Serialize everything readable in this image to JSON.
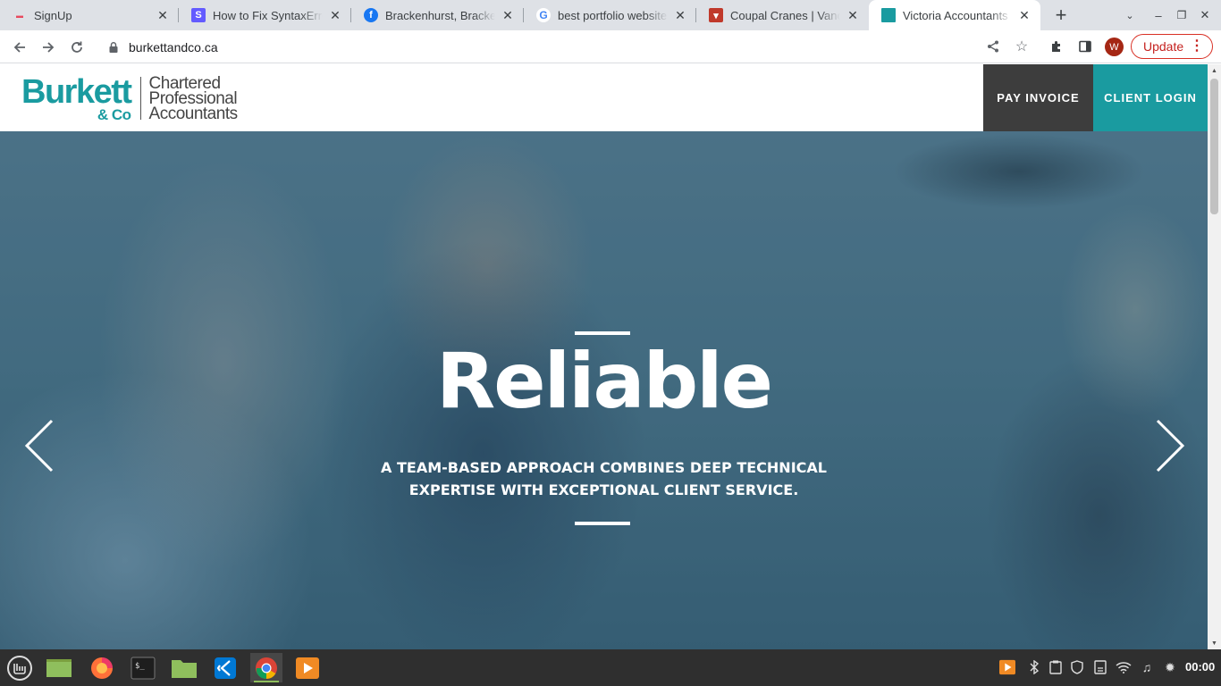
{
  "browser": {
    "tabs": [
      {
        "title": "SignUp",
        "favicon": "signup-favicon",
        "color": "#e84a5f"
      },
      {
        "title": "How to Fix SyntaxError",
        "favicon": "stripe-s-favicon",
        "color": "#635bff"
      },
      {
        "title": "Brackenhurst, Bracken",
        "favicon": "facebook-favicon",
        "color": "#1877f2"
      },
      {
        "title": "best portfolio website",
        "favicon": "google-favicon",
        "color": "#4285f4"
      },
      {
        "title": "Coupal Cranes | Vanc",
        "favicon": "coupal-favicon",
        "color": "#c0392b"
      },
      {
        "title": "Victoria Accountants |",
        "favicon": "burkett-favicon",
        "color": "#1a9ba0"
      }
    ],
    "active_tab": 5,
    "url": "burkettandco.ca",
    "profile_initial": "W",
    "update_label": "Update"
  },
  "site": {
    "logo": {
      "brand_main": "Burkett",
      "brand_sub": "& Co",
      "tag_line1": "Chartered",
      "tag_line2": "Professional",
      "tag_line3": "Accountants"
    },
    "nav": {
      "pay_invoice": "PAY INVOICE",
      "client_login": "CLIENT LOGIN"
    },
    "hero": {
      "title": "Reliable",
      "subtitle_line1": "A TEAM-BASED APPROACH COMBINES DEEP TECHNICAL",
      "subtitle_line2": "EXPERTISE WITH EXCEPTIONAL CLIENT SERVICE."
    },
    "colors": {
      "brand_teal": "#1a9ba0",
      "dark_button": "#3d3d3d"
    }
  },
  "taskbar": {
    "apps": [
      "mint-menu-icon",
      "files-icon",
      "firefox-icon",
      "terminal-icon",
      "folder-icon",
      "vscode-icon",
      "chrome-icon",
      "media-player-icon"
    ],
    "clock": "00:00"
  }
}
